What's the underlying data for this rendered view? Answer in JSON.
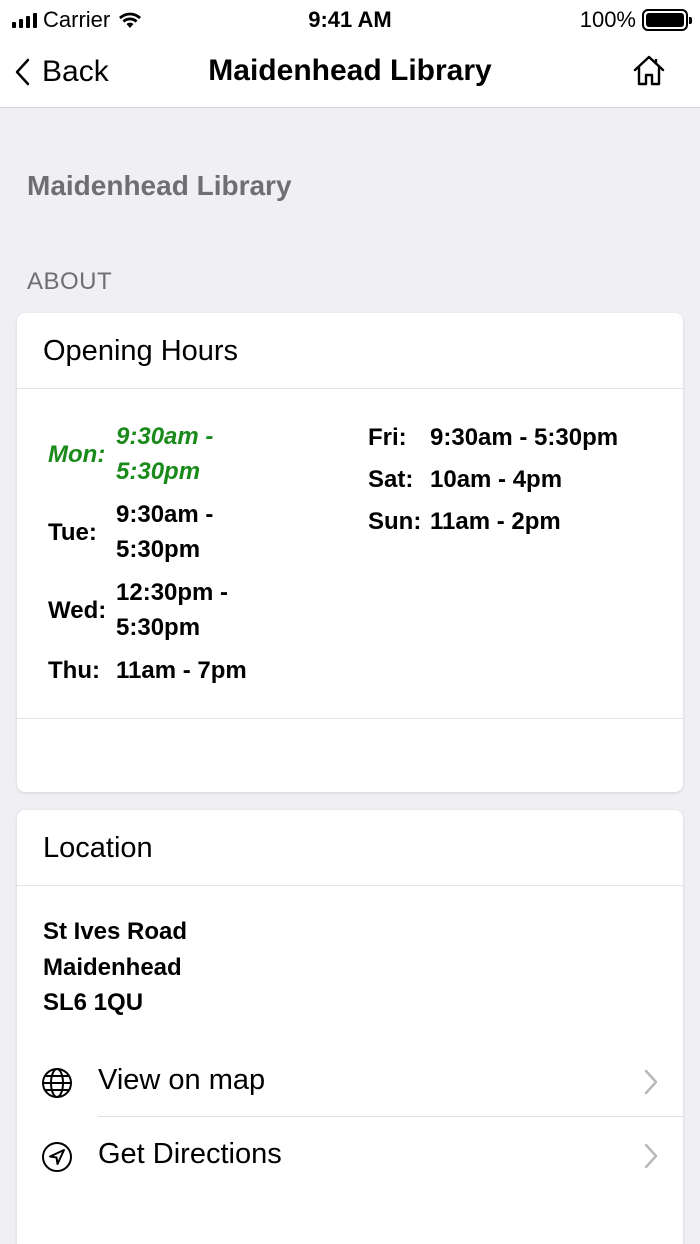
{
  "status_bar": {
    "carrier": "Carrier",
    "time": "9:41 AM",
    "battery": "100%"
  },
  "nav": {
    "back_label": "Back",
    "title": "Maidenhead Library",
    "home_icon": "home-icon"
  },
  "page": {
    "heading": "Maidenhead Library",
    "section_header": "ABOUT"
  },
  "opening_hours": {
    "title": "Opening Hours",
    "today_color": "#1a8a1a",
    "days": [
      {
        "day": "Mon:",
        "time": "9:30am - 5:30pm",
        "today": true
      },
      {
        "day": "Tue:",
        "time": "9:30am - 5:30pm",
        "today": false
      },
      {
        "day": "Wed:",
        "time": "12:30pm - 5:30pm",
        "today": false
      },
      {
        "day": "Thu:",
        "time": "11am - 7pm",
        "today": false
      },
      {
        "day": "Fri:",
        "time": "9:30am - 5:30pm",
        "today": false
      },
      {
        "day": "Sat:",
        "time": "10am - 4pm",
        "today": false
      },
      {
        "day": "Sun:",
        "time": "11am - 2pm",
        "today": false
      }
    ]
  },
  "location": {
    "title": "Location",
    "address": [
      "St Ives Road",
      "Maidenhead",
      "SL6 1QU"
    ],
    "actions": [
      {
        "label": "View on map",
        "icon": "globe-icon"
      },
      {
        "label": "Get Directions",
        "icon": "directions-icon"
      }
    ]
  }
}
